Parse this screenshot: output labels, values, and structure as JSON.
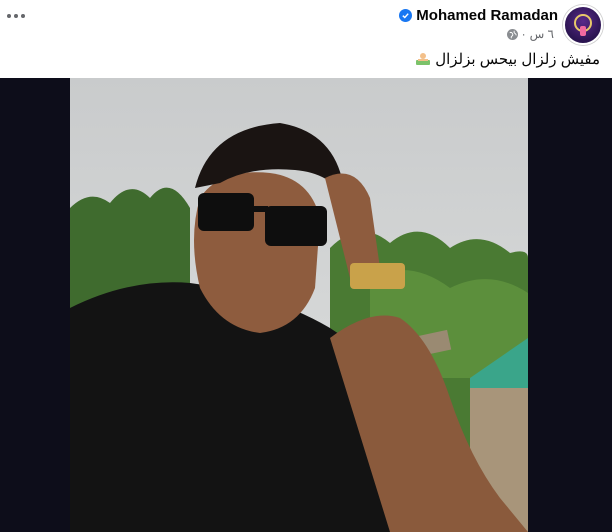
{
  "post": {
    "author_name": "Mohamed Ramadan",
    "time": "٦ س",
    "separator": "·",
    "text": "مفيش زلزال بيحس بزلزال",
    "verified": true,
    "audience_icon": "globe-icon",
    "text_emoji": "person-bathing-emoji"
  },
  "colors": {
    "name": "#050505",
    "meta": "#65676b",
    "verified": "#1877f2",
    "photo_frame": "#0d0d1a"
  },
  "icons": [
    "more-options-icon",
    "verified-badge-icon",
    "globe-icon"
  ]
}
